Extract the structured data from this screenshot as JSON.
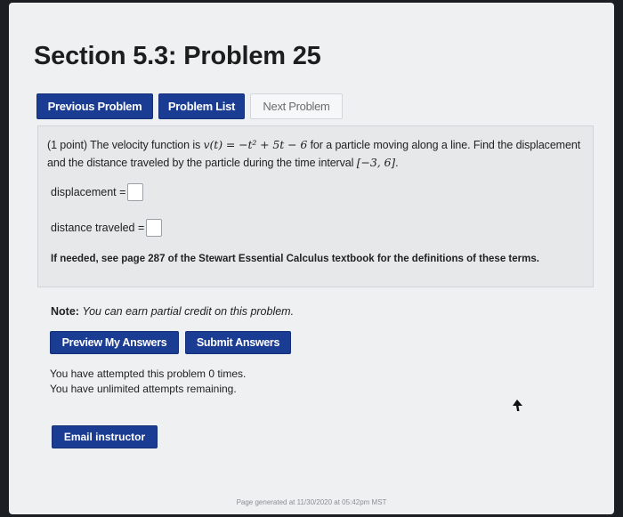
{
  "header": {
    "title": "Section 5.3: Problem 25"
  },
  "nav": {
    "previous_label": "Previous Problem",
    "list_label": "Problem List",
    "next_label": "Next Problem"
  },
  "problem": {
    "points": "(1 point)",
    "text_1": "The velocity function is",
    "velocity_function": "v(t) = −t² + 5t − 6",
    "text_2": "for a particle moving along a line. Find the displacement and the distance traveled by the particle during the time interval",
    "interval": "[−3, 6]",
    "period": ".",
    "displacement_label": "displacement =",
    "displacement_value": "",
    "distance_label": "distance traveled =",
    "distance_value": "",
    "hint": "If needed, see page 287 of the Stewart Essential Calculus textbook for the definitions of these terms."
  },
  "note": {
    "label": "Note:",
    "text": "You can earn partial credit on this problem."
  },
  "actions": {
    "preview_label": "Preview My Answers",
    "submit_label": "Submit Answers"
  },
  "status": {
    "attempts_line": "You have attempted this problem 0 times.",
    "remaining_line": "You have unlimited attempts remaining."
  },
  "email": {
    "label": "Email instructor"
  },
  "footer": {
    "text": "Page generated at 11/30/2020 at 05:42pm MST"
  },
  "colors": {
    "button_blue": "#1b3c93",
    "page_background": "#eef0f1",
    "problem_box": "#e6e8ea"
  }
}
